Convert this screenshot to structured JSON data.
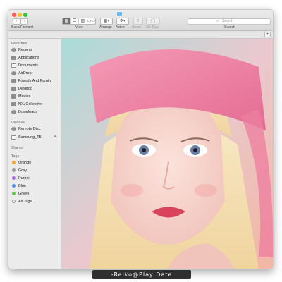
{
  "toolbar": {
    "nav_label": "Back/Forward",
    "view_label": "View",
    "arrange_label": "Arrange",
    "action_label": "Action",
    "share_label": "Share",
    "edit_tags_label": "Edit Tags",
    "search_label": "Search",
    "search_placeholder": "Search",
    "back_glyph": "‹",
    "forward_glyph": "›",
    "view_modes": [
      "▦",
      "☰",
      "▥",
      "▭▭"
    ],
    "arrange_glyph": "▦▾",
    "action_glyph": "✲▾",
    "share_glyph": "⇧",
    "tags_glyph": "◯",
    "search_glyph": "⌕",
    "add_glyph": "+"
  },
  "sidebar": {
    "favorites_header": "Favorites",
    "favorites": [
      {
        "label": "Recents",
        "icon": "clock-icon"
      },
      {
        "label": "Applications",
        "icon": "applications-icon"
      },
      {
        "label": "Documents",
        "icon": "document-icon"
      },
      {
        "label": "AirDrop",
        "icon": "airdrop-icon"
      },
      {
        "label": "Friends And Family",
        "icon": "folder-icon"
      },
      {
        "label": "Desktop",
        "icon": "desktop-icon"
      },
      {
        "label": "Movies",
        "icon": "film-icon"
      },
      {
        "label": "NXJCollective",
        "icon": "folder-icon"
      },
      {
        "label": "Downloads",
        "icon": "download-icon"
      }
    ],
    "devices_header": "Devices",
    "devices": [
      {
        "label": "Remote Disc",
        "icon": "disc-icon"
      },
      {
        "label": "Samsung_T5",
        "icon": "drive-icon",
        "eject": "⏏"
      }
    ],
    "shared_header": "Shared",
    "tags_header": "Tags",
    "tags": [
      {
        "label": "Orange",
        "color": "#f5a623"
      },
      {
        "label": "Gray",
        "color": "#9b9b9b"
      },
      {
        "label": "Purple",
        "color": "#b36ae2"
      },
      {
        "label": "Blue",
        "color": "#4a90e2"
      },
      {
        "label": "Green",
        "color": "#5fc94a"
      },
      {
        "label": "All Tags...",
        "color": ""
      }
    ]
  },
  "watermark": "-Reiko@Play Date",
  "colors": {
    "close": "#fc5f57",
    "minimize": "#fdbc2e",
    "maximize": "#28c840",
    "bandana": "#ee7fa0",
    "hair": "#f3e1b8",
    "background": "#a9dcd8"
  }
}
